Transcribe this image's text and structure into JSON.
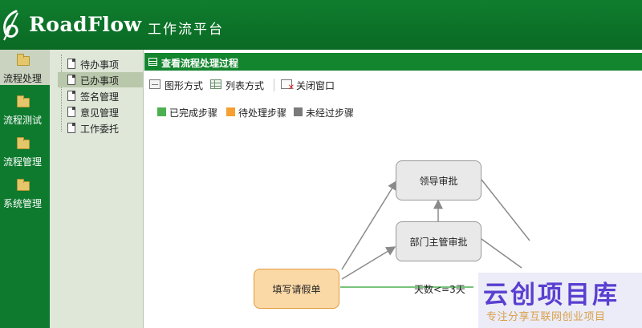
{
  "app": {
    "brand": "RoadFlow",
    "subtitle": "工作流平台"
  },
  "modules": [
    {
      "label": "流程处理",
      "active": true
    },
    {
      "label": "流程测试",
      "active": false
    },
    {
      "label": "流程管理",
      "active": false
    },
    {
      "label": "系统管理",
      "active": false
    }
  ],
  "tree": [
    {
      "label": "待办事项",
      "active": false
    },
    {
      "label": "已办事项",
      "active": true
    },
    {
      "label": "签名管理",
      "active": false
    },
    {
      "label": "意见管理",
      "active": false
    },
    {
      "label": "工作委托",
      "active": false
    }
  ],
  "panel": {
    "title": "查看流程处理过程"
  },
  "toolbar": {
    "graph_label": "图形方式",
    "list_label": "列表方式",
    "close_label": "关闭窗口"
  },
  "legend": [
    {
      "label": "已完成步骤",
      "color": "#4caf50"
    },
    {
      "label": "待处理步骤",
      "color": "#f5a030"
    },
    {
      "label": "未经过步骤",
      "color": "#7a7a7a"
    }
  ],
  "flow": {
    "nodes": {
      "leader": "领导审批",
      "dept": "部门主管审批",
      "apply": "填写请假单"
    },
    "edge_label": "天数<=3天"
  },
  "watermark": {
    "main": "云创项目库",
    "sub": "专注分享互联网创业项目"
  }
}
